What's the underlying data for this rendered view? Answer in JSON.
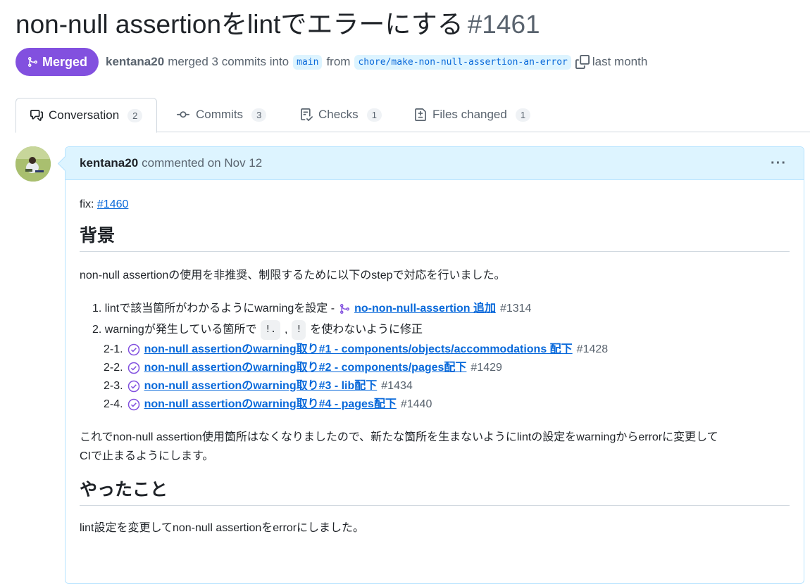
{
  "pr": {
    "title": "non-null assertionをlintでエラーにする",
    "number": "#1461",
    "status": "Merged",
    "author": "kentana20",
    "merged_text": "merged 3 commits into",
    "base_branch": "main",
    "from_text": "from",
    "head_branch": "chore/make-non-null-assertion-an-error",
    "time": "last month"
  },
  "tabs": [
    {
      "label": "Conversation",
      "count": "2",
      "icon": "comment-discussion-icon"
    },
    {
      "label": "Commits",
      "count": "3",
      "icon": "git-commit-icon"
    },
    {
      "label": "Checks",
      "count": "1",
      "icon": "checklist-icon"
    },
    {
      "label": "Files changed",
      "count": "1",
      "icon": "file-diff-icon"
    }
  ],
  "comment": {
    "author": "kentana20",
    "meta": "commented on Nov 12",
    "more": "···",
    "fix_label": "fix:",
    "fix_link": "#1460",
    "heading1": "背景",
    "para1": "non-null assertionの使用を非推奨、制限するために以下のstepで対応を行いました。",
    "list": {
      "item1_prefix": "1. lintで該当箇所がわかるようにwarningを設定 -",
      "item1_link": "no-non-null-assertion 追加",
      "item1_num": "#1314",
      "item2_prefix": "2. warningが発生している箇所で",
      "item2_code1": "!.",
      "item2_sep": ",",
      "item2_code2": "!",
      "item2_suffix": "を使わないように修正",
      "sub": [
        {
          "n": "2-1.",
          "link": "non-null assertionのwarning取り#1 - components/objects/accommodations 配下",
          "num": "#1428"
        },
        {
          "n": "2-2.",
          "link": "non-null assertionのwarning取り#2 - components/pages配下",
          "num": "#1429"
        },
        {
          "n": "2-3.",
          "link": "non-null assertionのwarning取り#3 - lib配下",
          "num": "#1434"
        },
        {
          "n": "2-4.",
          "link": "non-null assertionのwarning取り#4 - pages配下",
          "num": "#1440"
        }
      ]
    },
    "para2_line1": "これでnon-null assertion使用箇所はなくなりましたので、新たな箇所を生まないようにlintの設定をwarningからerrorに変更して",
    "para2_line2": "CIで止まるようにします。",
    "heading2": "やったこと",
    "para3": "lint設定を変更してnon-null assertionをerrorにしました。"
  },
  "colors": {
    "merged": "#8250df",
    "link": "#0969da",
    "header_bg": "#ddf4ff"
  }
}
